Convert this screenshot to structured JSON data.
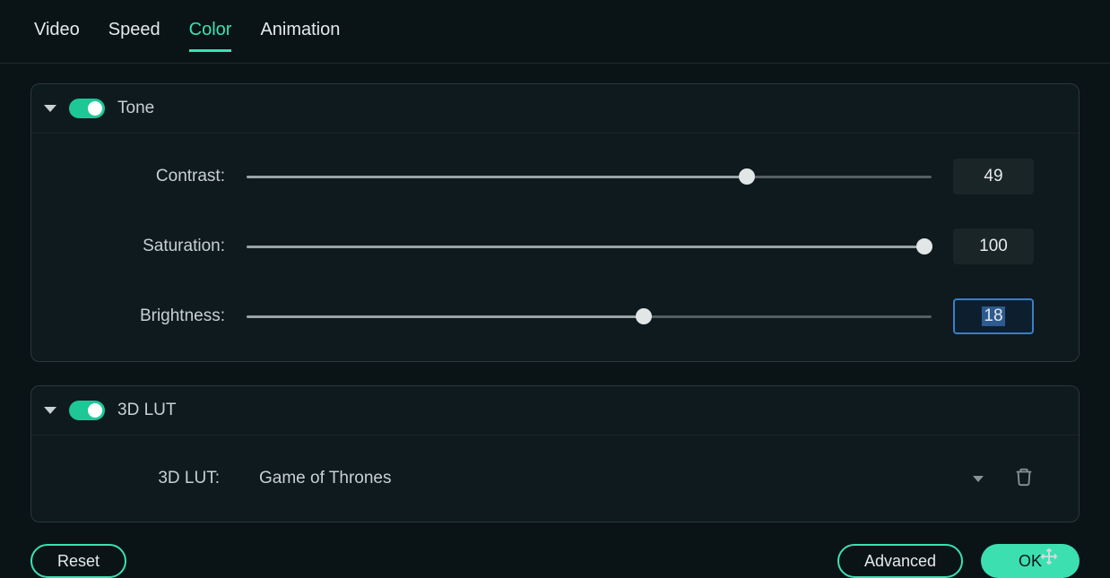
{
  "tabs": {
    "items": [
      {
        "label": "Video",
        "active": false
      },
      {
        "label": "Speed",
        "active": false
      },
      {
        "label": "Color",
        "active": true
      },
      {
        "label": "Animation",
        "active": false
      }
    ]
  },
  "tone": {
    "title": "Tone",
    "enabled": true,
    "contrast": {
      "label": "Contrast:",
      "value": "49",
      "percent": 73
    },
    "saturation": {
      "label": "Saturation:",
      "value": "100",
      "percent": 99
    },
    "brightness": {
      "label": "Brightness:",
      "value": "18",
      "percent": 58,
      "selected": true
    }
  },
  "lut": {
    "title": "3D LUT",
    "enabled": true,
    "field_label": "3D LUT:",
    "selected": "Game of Thrones"
  },
  "footer": {
    "reset": "Reset",
    "advanced": "Advanced",
    "ok": "OK"
  }
}
